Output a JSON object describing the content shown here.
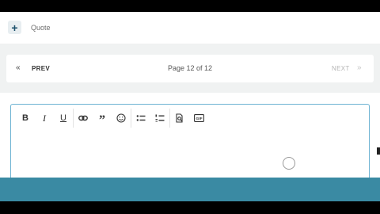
{
  "composer": {
    "add_icon": "plus-icon",
    "add_glyph": "+",
    "quote_label": "Quote"
  },
  "pager": {
    "prev_label": "PREV",
    "prev_icon": "double-chevron-left-icon",
    "page_info": "Page 12 of 12",
    "next_label": "NEXT",
    "next_icon": "double-chevron-right-icon",
    "next_disabled": true
  },
  "toolbar": {
    "bold": "B",
    "italic": "I",
    "underline": "U",
    "link_icon": "link-icon",
    "quote_icon": "quote-icon",
    "emoji_icon": "emoji-icon",
    "bullet_list_icon": "bullet-list-icon",
    "numbered_list_icon": "numbered-list-icon",
    "image_search_icon": "image-search-icon",
    "gif_icon": "gif-icon",
    "gif_text": "GIF"
  },
  "colors": {
    "accent_border": "#6eb3d3",
    "footer_bar": "#3a8aa3",
    "plus_color": "#1b4f6b"
  }
}
